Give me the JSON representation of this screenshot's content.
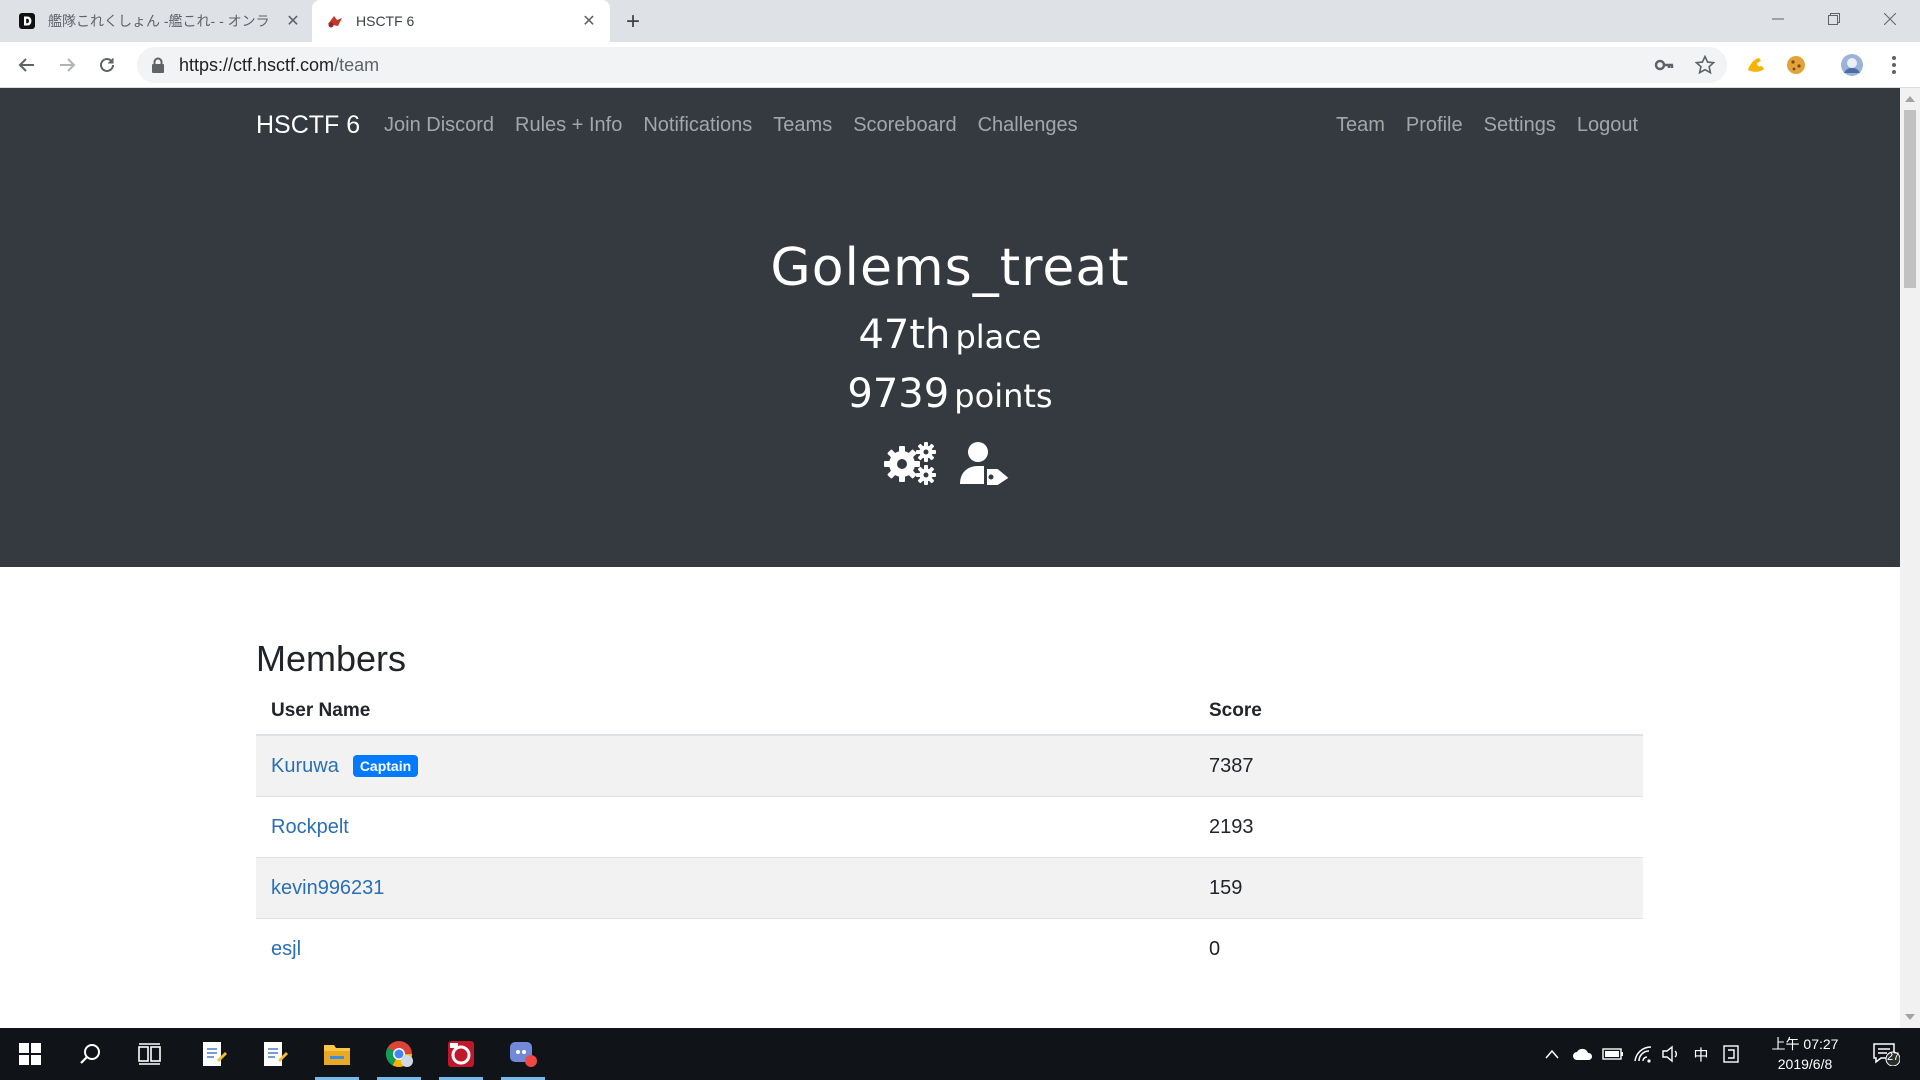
{
  "browser": {
    "tabs": [
      {
        "title": "艦隊これくしょん -艦これ- - オンラ",
        "active": false
      },
      {
        "title": "HSCTF 6",
        "active": true
      }
    ],
    "url_host": "https://ctf.hsctf.com",
    "url_path": "/team",
    "colors": {
      "tabstrip": "#dee1e6",
      "toolbar": "#ffffff"
    }
  },
  "navbar": {
    "brand": "HSCTF 6",
    "left_links": [
      {
        "label": "Join Discord"
      },
      {
        "label": "Rules + Info"
      },
      {
        "label": "Notifications"
      },
      {
        "label": "Teams"
      },
      {
        "label": "Scoreboard"
      },
      {
        "label": "Challenges"
      }
    ],
    "right_links": [
      {
        "label": "Team"
      },
      {
        "label": "Profile"
      },
      {
        "label": "Settings"
      },
      {
        "label": "Logout"
      }
    ],
    "colors": {
      "background": "#343a40",
      "link": "rgba(255,255,255,0.55)",
      "brand": "#ffffff"
    }
  },
  "team": {
    "name": "Golems_treat",
    "place_number": "47th",
    "place_word": "place",
    "points_number": "9739",
    "points_word": "points",
    "icons": [
      "team-settings-icon",
      "user-tag-icon"
    ]
  },
  "members": {
    "heading": "Members",
    "columns": {
      "user": "User Name",
      "score": "Score"
    },
    "rows": [
      {
        "user": "Kuruwa",
        "badge": "Captain",
        "score": "7387"
      },
      {
        "user": "Rockpelt",
        "badge": "",
        "score": "2193"
      },
      {
        "user": "kevin996231",
        "badge": "",
        "score": "159"
      },
      {
        "user": "esjl",
        "badge": "",
        "score": "0"
      }
    ],
    "colors": {
      "link": "#2a6fb5",
      "badge": "#007bff",
      "stripe": "#f2f2f2"
    }
  },
  "taskbar": {
    "clock_time": "上午 07:27",
    "clock_date": "2019/6/8",
    "ime": "中",
    "notification_count": "27",
    "colors": {
      "background": "#101418",
      "active_indicator": "#76b9ed"
    }
  }
}
